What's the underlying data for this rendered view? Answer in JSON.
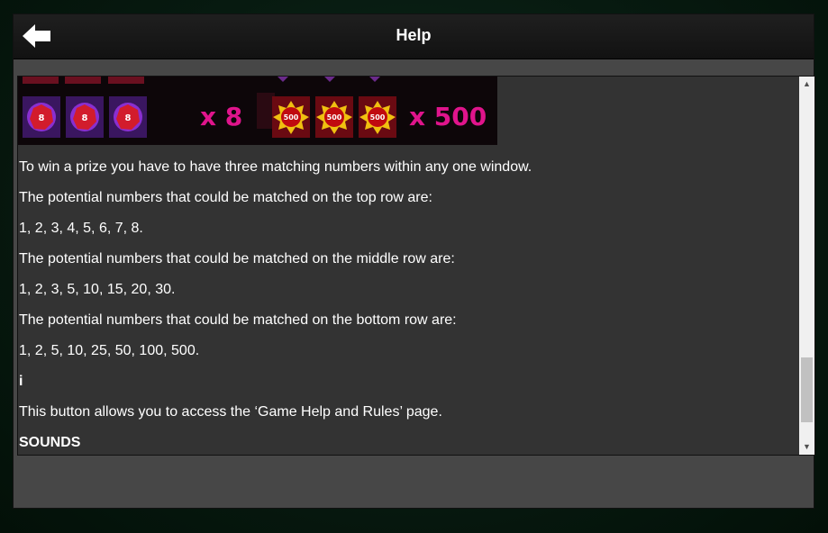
{
  "header": {
    "title": "Help",
    "back_icon": "left-arrow-icon"
  },
  "banner": {
    "left_symbol_number": "8",
    "left_multiplier": "x 8",
    "right_symbol_number": "500",
    "right_multiplier": "x 500"
  },
  "content": {
    "paragraphs": [
      "To win a prize you have to have three matching numbers within any one window.",
      "The potential numbers that could be matched on the top row are:",
      "1, 2, 3, 4, 5, 6, 7, 8.",
      "The potential numbers that could be matched on the middle row are:",
      "1, 2, 3, 5, 10, 15, 20, 30.",
      "The potential numbers that could be matched on the bottom row are:",
      "1, 2, 5, 10, 25, 50, 100, 500."
    ],
    "info_icon_label": "i",
    "info_description": "This button allows you to access the ‘Game Help and Rules’ page.",
    "sounds_heading": "SOUNDS"
  },
  "colors": {
    "multiplier": "#e0148c",
    "panel_bg": "#474747",
    "content_bg": "#333333"
  }
}
